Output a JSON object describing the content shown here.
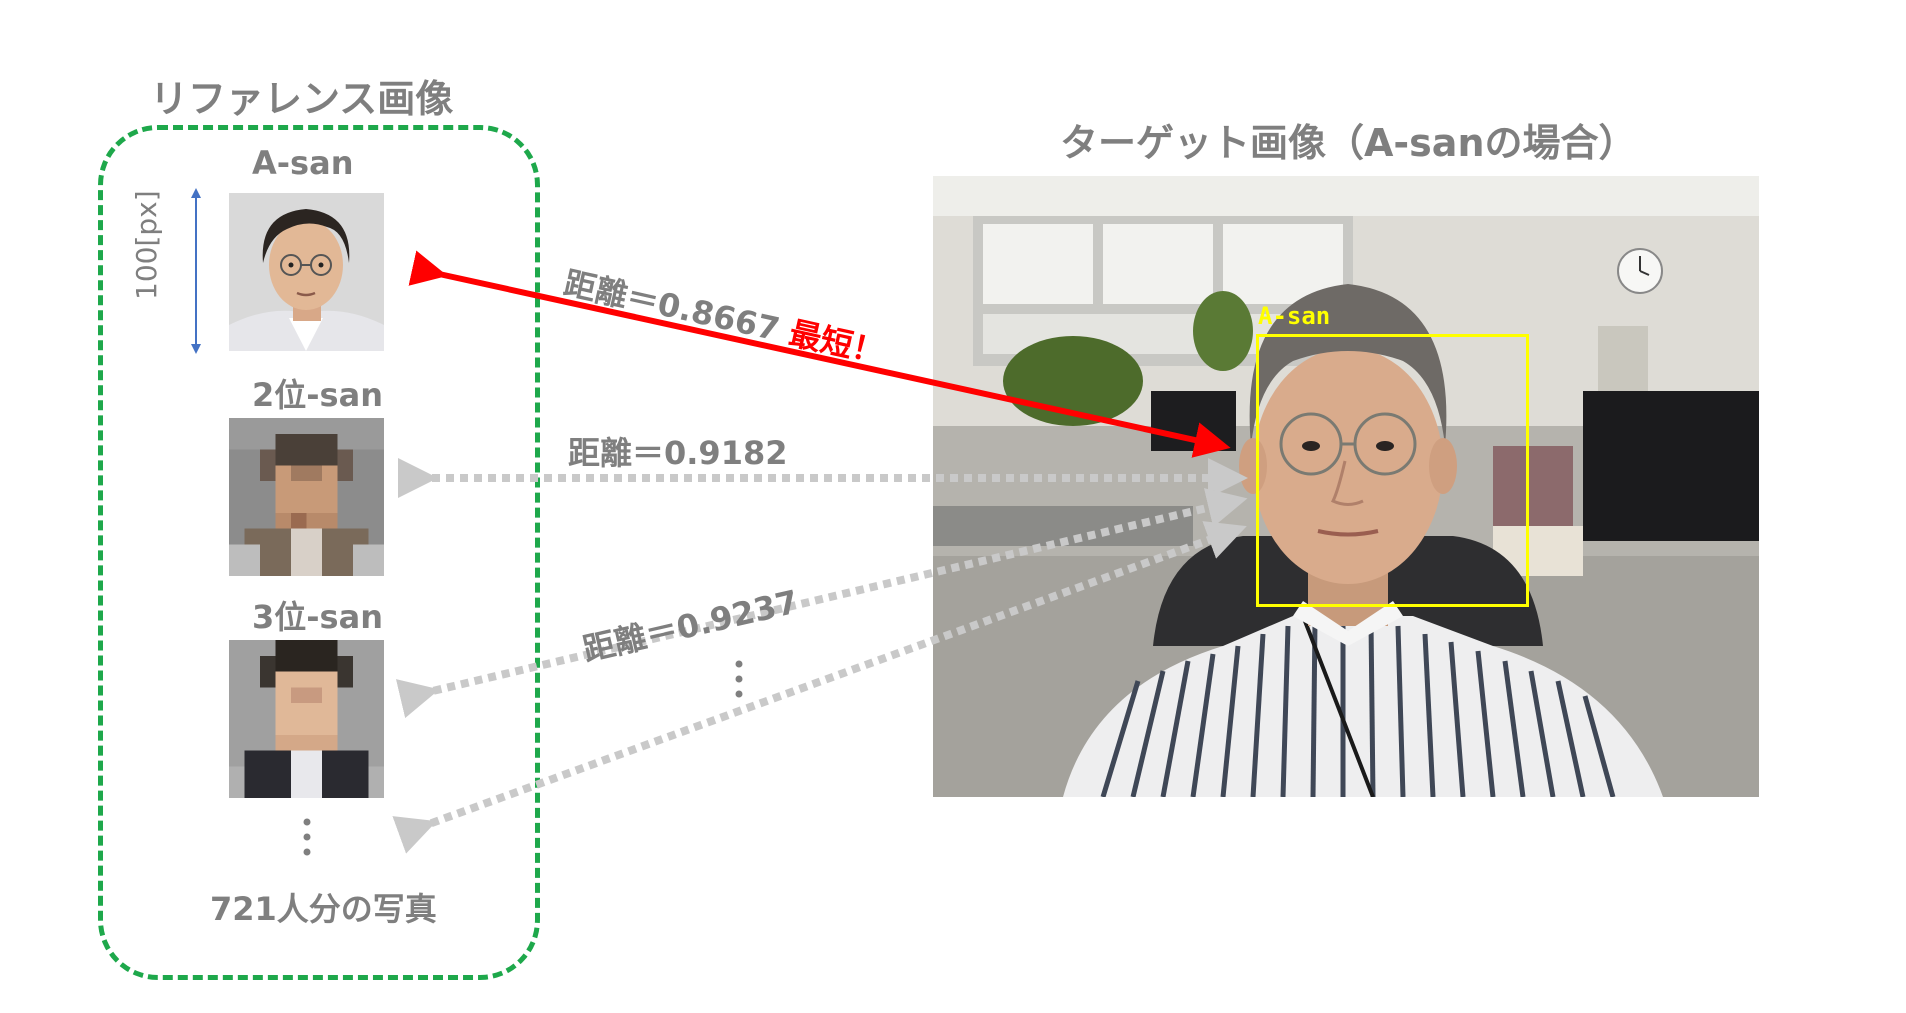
{
  "reference": {
    "title": "リファレンス画像",
    "size_label": "100[px]",
    "faces": [
      {
        "label": "A-san"
      },
      {
        "label": "2位-san"
      },
      {
        "label": "3位-san"
      }
    ],
    "count_label": "721人分の写真"
  },
  "target": {
    "title": "ターゲット画像（A-sanの場合）",
    "detection_label": "A-san"
  },
  "distances": [
    {
      "label": "距離＝0.8667",
      "badge": "最短！"
    },
    {
      "label": "距離＝0.9182"
    },
    {
      "label": "距離＝0.9237"
    }
  ],
  "colors": {
    "best_arrow": "#ff0000",
    "other_arrow": "#c9c9c9",
    "reference_border": "#1ea84b",
    "detection_box": "#ffff00",
    "size_arrow": "#4472c4"
  }
}
